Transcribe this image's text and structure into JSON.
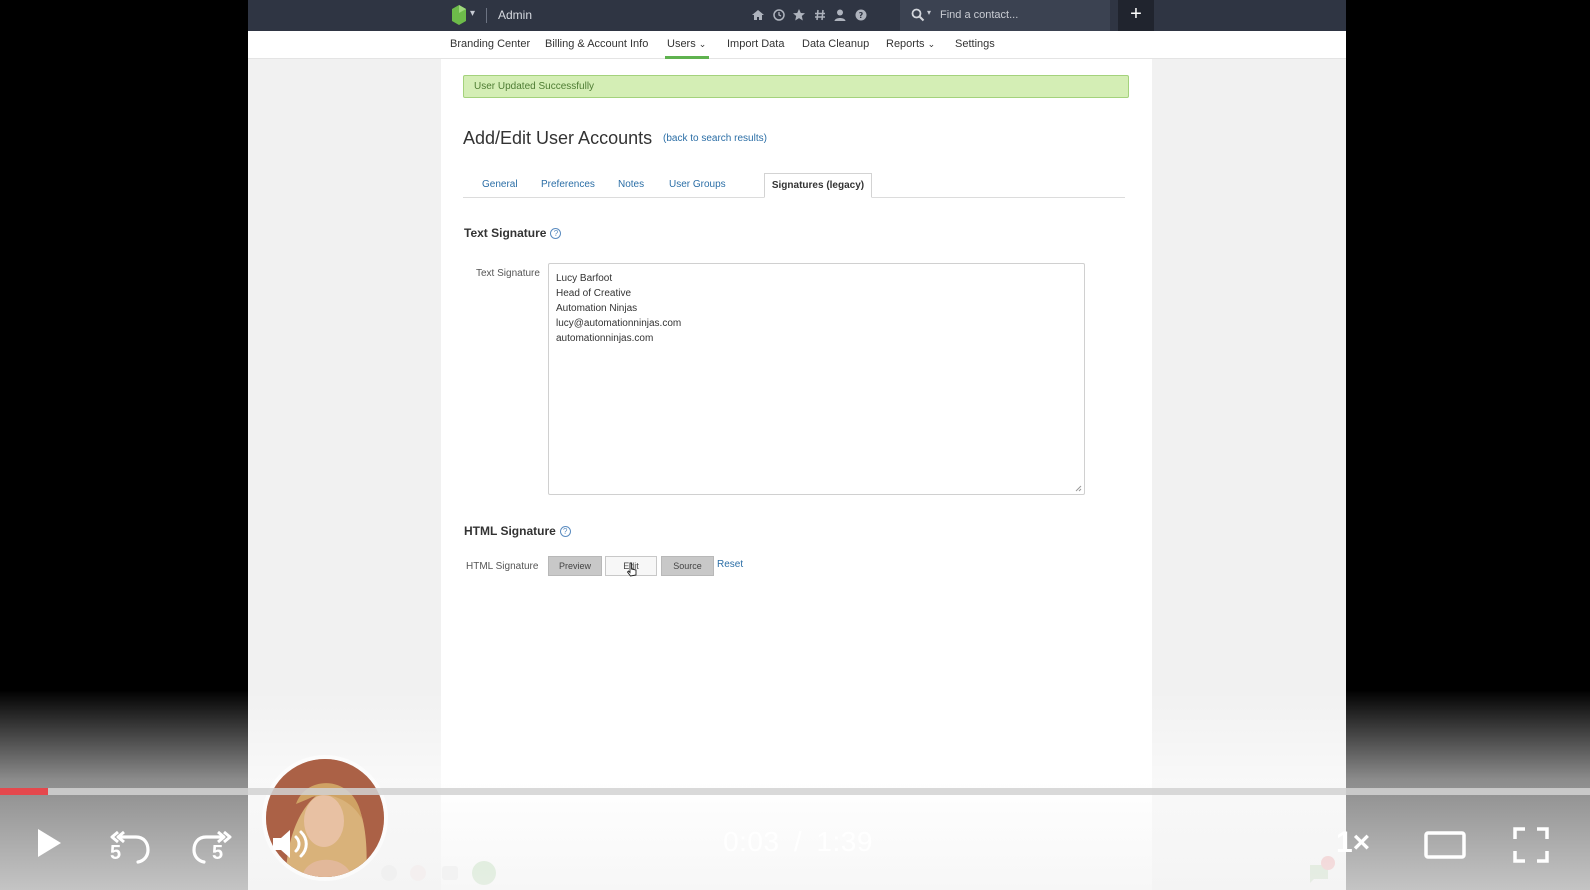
{
  "app": {
    "title": "Admin",
    "search": {
      "placeholder": "Find a contact..."
    },
    "add_label": "+"
  },
  "nav": {
    "items": [
      {
        "label": "Branding Center"
      },
      {
        "label": "Billing & Account Info"
      },
      {
        "label": "Users"
      },
      {
        "label": "Import Data"
      },
      {
        "label": "Data Cleanup"
      },
      {
        "label": "Reports"
      },
      {
        "label": "Settings"
      }
    ],
    "active": "Users"
  },
  "banner": {
    "text": "User Updated Successfully"
  },
  "page": {
    "title": "Add/Edit User Accounts",
    "back_link": "(back to search results)"
  },
  "tabs": [
    {
      "label": "General"
    },
    {
      "label": "Preferences"
    },
    {
      "label": "Notes"
    },
    {
      "label": "User Groups"
    },
    {
      "label": "Signatures (legacy)"
    }
  ],
  "text_signature": {
    "heading": "Text Signature",
    "field_label": "Text Signature",
    "lines": [
      "Lucy Barfoot",
      "Head of Creative",
      "Automation Ninjas",
      "lucy@automationninjas.com",
      "automationninjas.com"
    ]
  },
  "html_signature": {
    "heading": "HTML Signature",
    "field_label": "HTML Signature",
    "buttons": {
      "preview": "Preview",
      "edit": "Edit",
      "source": "Source"
    },
    "reset": "Reset"
  },
  "player": {
    "current_time": "0:03",
    "separator": "/",
    "duration": "1:39",
    "progress": 0.03,
    "speed": "1×",
    "state": "paused",
    "rewind_seconds": "5",
    "forward_seconds": "5"
  },
  "colors": {
    "accent_progress": "#e5484d",
    "topbar": "#2f3543",
    "link": "#2b6ea6",
    "success_bg": "#d4eeb5",
    "nav_active": "#5fb24f"
  },
  "icons": [
    "home-icon",
    "clock-icon",
    "star-icon",
    "hashtag-icon",
    "user-icon",
    "help-icon",
    "search-icon",
    "play-icon",
    "rewind-5-icon",
    "forward-5-icon",
    "volume-icon",
    "theater-mode-icon",
    "fullscreen-icon"
  ]
}
